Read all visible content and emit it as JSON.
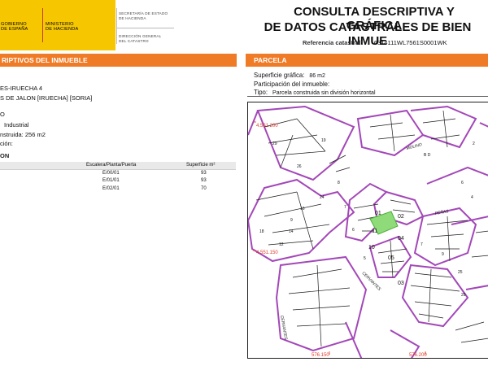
{
  "header": {
    "logo_left": [
      "GOBIERNO",
      "DE ESPAÑA"
    ],
    "logo_right": [
      "MINISTERIO",
      "DE HACIENDA"
    ],
    "org_a": [
      "SECRETARÍA DE ESTADO",
      "DE HACIENDA"
    ],
    "org_b": [
      "DIRECCIÓN GENERAL",
      "DEL CATASTRO"
    ],
    "title_line1": "CONSULTA DESCRIPTIVA Y GRÁFICA",
    "title_line2": "DE DATOS CATASTRALES DE BIEN INMUE",
    "ref_label": "Referencia catastral:",
    "ref_value": "6314111WL7561S0001WK"
  },
  "left_panel": {
    "bar_title": "RIPTIVOS DEL INMUEBLE",
    "address_line1": "ES-IRUECHA 4",
    "address_line2": "S DE JALON [IRUECHA] [SORIA]",
    "clase_frag": "O",
    "uso_value": "Industrial",
    "construida_frag": "nstruida:",
    "construida_value": "256 m2",
    "ion_frag": "ción:",
    "section_frag": "ON",
    "table": {
      "headers": [
        "Escalera/Planta/Puerta",
        "Superficie m²"
      ],
      "rows": [
        {
          "planta": "E/00/01",
          "superficie": "93"
        },
        {
          "planta": "E/01/01",
          "superficie": "93"
        },
        {
          "planta": "E/02/01",
          "superficie": "70"
        }
      ]
    }
  },
  "right_panel": {
    "bar_title": "PARCELA",
    "sup_label": "Superficie gráfica:",
    "sup_value": "86 m2",
    "part_label": "Participación del inmueble:",
    "tipo_label": "Tipo:",
    "tipo_value": "Parcela construida sin división horizontal"
  },
  "map": {
    "coord_top": "4.551.200",
    "coord_mid": "4.551.150",
    "coord_bl": "576.150",
    "coord_br": "576.200",
    "parcel_labels": [
      "01",
      "02",
      "11",
      "04",
      "10",
      "05",
      "03"
    ],
    "street_labels": [
      "MOLINO",
      "PEÑAS",
      "CERVANTES",
      "CERVANTES"
    ],
    "small_labels": [
      "B D",
      "2",
      "6",
      "4",
      "19",
      "9",
      "8",
      "7",
      "6",
      "5",
      "29",
      "26",
      "24",
      "16",
      "14",
      "12",
      "18",
      "9",
      "25",
      "29",
      "7"
    ],
    "colors": {
      "parcel_line": "#a347b8",
      "building_line": "#1a1a1a",
      "highlight": "#8fdb7a",
      "highlight_line": "#4caf3a"
    }
  }
}
